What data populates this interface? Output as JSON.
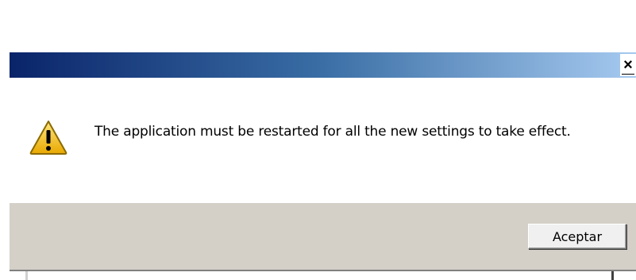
{
  "window": {
    "close_label": "×"
  },
  "message": {
    "text": "The application must be restarted for all the new settings to take effect.",
    "icon": "warning-icon"
  },
  "buttons": {
    "ok_label": "Aceptar"
  },
  "colors": {
    "titlebar_start": "#0a246a",
    "titlebar_end": "#a6caf0",
    "footer_bg": "#d4d0c8",
    "warning_fill": "#f6c700"
  }
}
